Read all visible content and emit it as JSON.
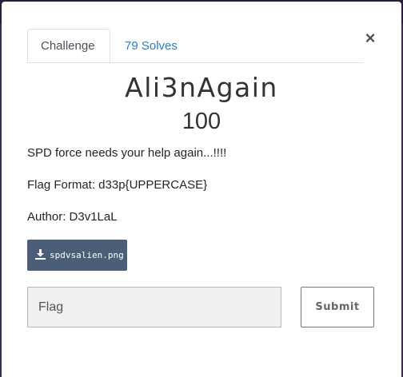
{
  "modal": {
    "tabs": [
      {
        "label": "Challenge"
      },
      {
        "label": "79 Solves"
      }
    ],
    "close_label": "×",
    "title": "Ali3nAgain",
    "points": "100",
    "description": [
      "SPD force needs your help again...!!!!",
      "Flag Format: d33p{UPPERCASE}",
      "Author: D3v1LaL"
    ],
    "file": {
      "label": "spdvsalien.png",
      "icon": "download-icon"
    },
    "flag_input": {
      "placeholder": "Flag",
      "value": ""
    },
    "submit_label": "Submit"
  },
  "colors": {
    "accent_link": "#2c7cc0",
    "file_button_bg": "#4c5d77"
  }
}
